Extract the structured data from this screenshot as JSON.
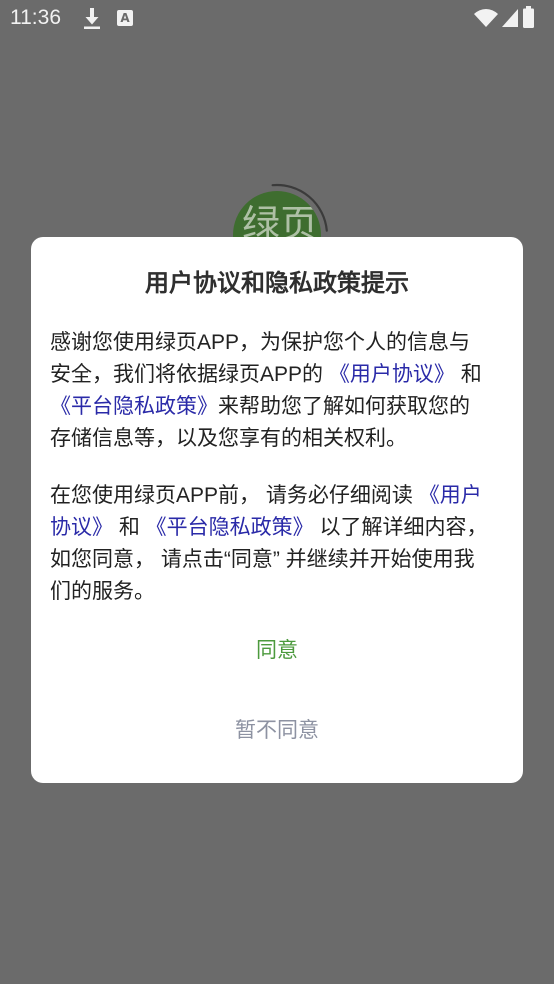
{
  "status_bar": {
    "time": "11:36",
    "a_icon_letter": "A",
    "icons": {
      "left": [
        "download-icon",
        "font-a-icon"
      ],
      "right": [
        "wifi-icon",
        "signal-icon",
        "battery-icon"
      ]
    }
  },
  "background_app": {
    "logo_text": "绿页"
  },
  "colors": {
    "screen_overlay": "#6b6b6b",
    "status_icons": "#f2f2f2",
    "logo_fill": "#3e6d2f",
    "logo_text": "#aec0a5",
    "logo_ring": "#3b3b3b",
    "dialog_background": "#ffffff",
    "title_text": "#2f2f2f",
    "body_text": "#222222",
    "link_text": "#2a2aa8",
    "agree_text": "#4c9a3d",
    "disagree_text": "#8d92a2"
  },
  "dialog": {
    "title": "用户协议和隐私政策提示",
    "intro": {
      "text_before": "感谢您使用绿页APP，为保护您个人的信息与安全，我们将依据绿页APP的 ",
      "user_agreement_link": "《用户协议》",
      "connector": " 和 ",
      "privacy_policy_link": "《平台隐私政策》",
      "text_after": "来帮助您了解如何获取您的存储信息等，以及您享有的相关权利。"
    },
    "notice": {
      "text_before": "在您使用绿页APP前， 请务必仔细阅读 ",
      "user_agreement_link": "《用户协议》",
      "connector": " 和 ",
      "privacy_policy_link": "《平台隐私政策》",
      "text_after": " 以了解详细内容，如您同意， 请点击“同意” 并继续并开始使用我们的服务。"
    },
    "agree_button": "同意",
    "disagree_button": "暂不同意"
  }
}
